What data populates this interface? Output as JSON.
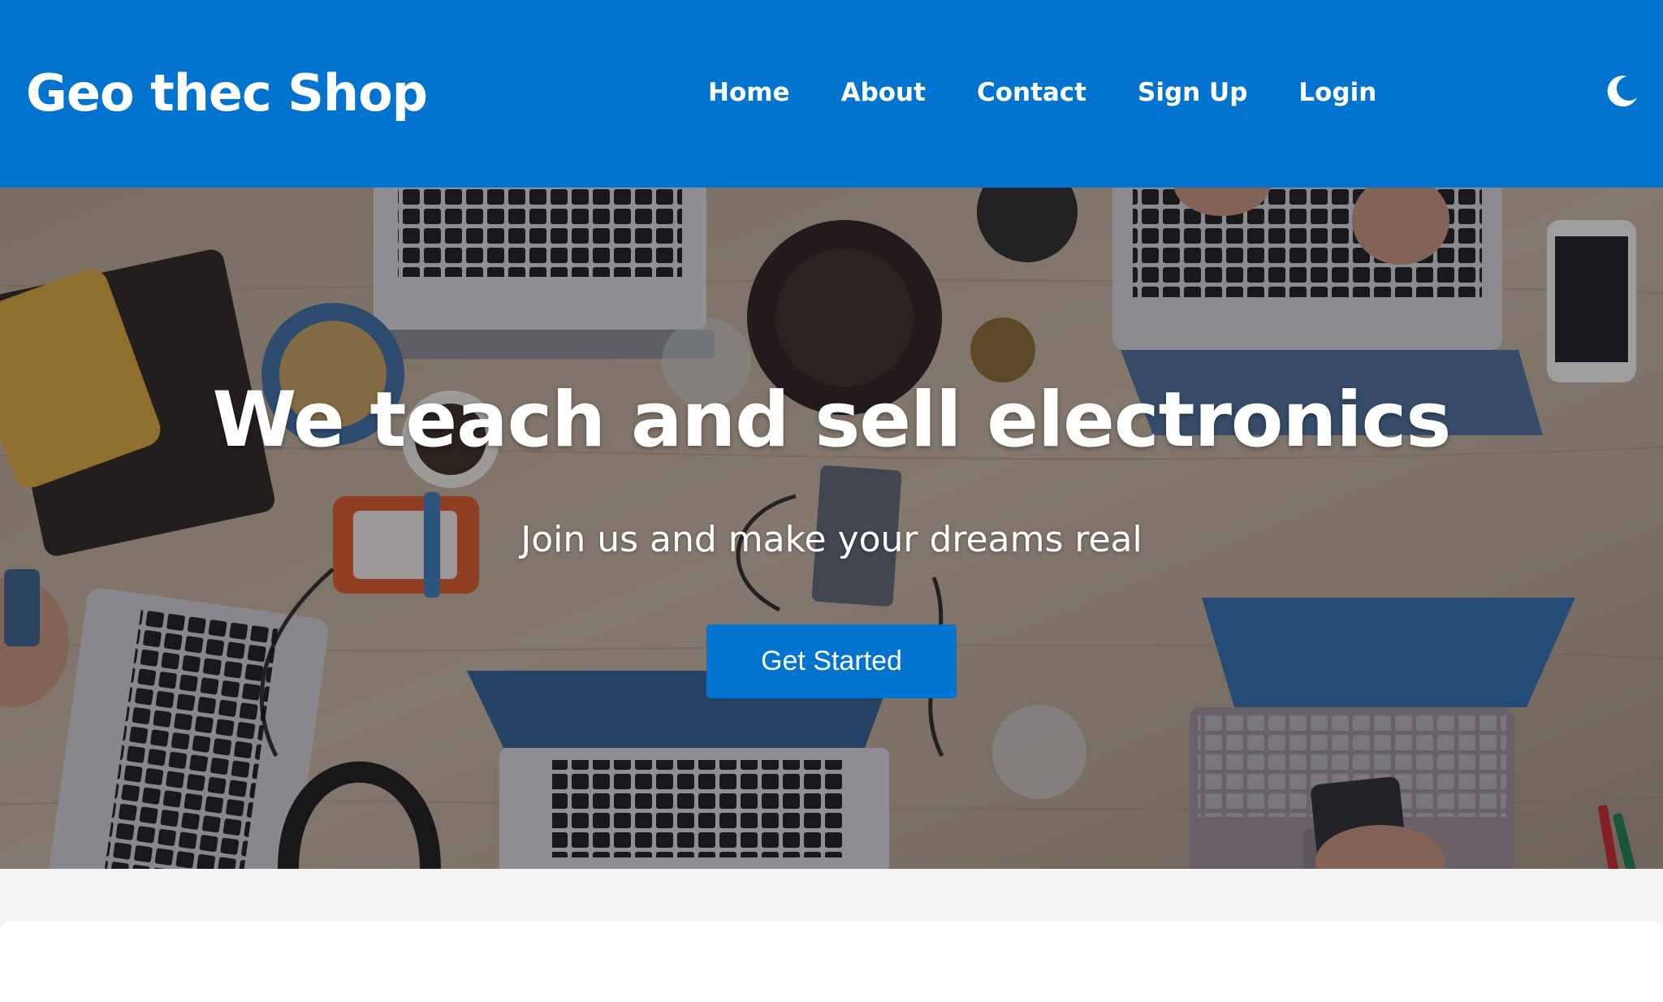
{
  "header": {
    "brand": "Geo thec Shop",
    "nav": [
      {
        "label": "Home"
      },
      {
        "label": "About"
      },
      {
        "label": "Contact"
      },
      {
        "label": "Sign Up"
      },
      {
        "label": "Login"
      }
    ],
    "theme_toggle_icon": "moon-icon"
  },
  "hero": {
    "title": "We teach and sell electronics",
    "subtitle": "Join us and make your dreams real",
    "cta_label": "Get Started",
    "background_image": "overhead-desk-laptops-photo"
  },
  "colors": {
    "primary": "#0274d0",
    "page_background": "#f4f4f4",
    "text_on_primary": "#ffffff"
  }
}
